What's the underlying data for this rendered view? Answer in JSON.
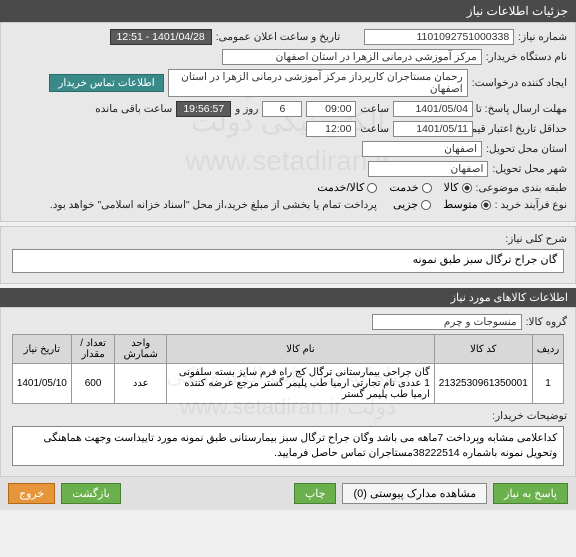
{
  "header": {
    "title": "جزئیات اطلاعات نیاز"
  },
  "form": {
    "need_no_label": "شماره نیاز:",
    "need_no": "1101092751000338",
    "announce_label": "تاریخ و ساعت اعلان عمومی:",
    "announce": "1401/04/28 - 12:51",
    "buyer_label": "نام دستگاه خریدار:",
    "buyer": "مرکز آموزشی درمانی الزهرا در استان اصفهان",
    "requester_label": "ایجاد کننده درخواست:",
    "requester": "رحمان مستاجران کارپرداز مرکز آموزشی درمانی الزهرا در استان اصفهان",
    "contact_btn": "اطلاعات تماس خریدار",
    "deadline_label": "مهلت ارسال پاسخ: تا تاریخ:",
    "deadline_date": "1401/05/04",
    "hour_label": "ساعت",
    "deadline_hour": "09:00",
    "days_left_pre": "",
    "days_left": "6",
    "days_left_mid": "روز و",
    "time_left": "19:56:57",
    "time_left_post": "ساعت باقی مانده",
    "validity_label": "حداقل تاریخ اعتبار قیمت: تا تاریخ:",
    "validity_date": "1401/05/11",
    "validity_hour": "12:00",
    "delivery_prov_label": "استان محل تحویل:",
    "delivery_prov": "اصفهان",
    "delivery_city_label": "شهر محل تحویل:",
    "delivery_city": "اصفهان",
    "classify_label": "طبقه بندی موضوعی:",
    "opt_goods": "کالا",
    "opt_service": "خدمت",
    "opt_both": "کالا/خدمت",
    "buy_type_label": "نوع فرآیند خرید :",
    "opt_mid": "متوسط",
    "opt_small": "جزیی",
    "buy_type_note": "پرداخت تمام یا بخشی از مبلغ خرید،از محل \"اسناد خزانه اسلامی\" خواهد بود."
  },
  "need_desc": {
    "label": "شرح کلی نیاز:",
    "text": "گان جراح ترگال سبز طبق نمونه"
  },
  "goods_section": {
    "title": "اطلاعات کالاهای مورد نیاز",
    "group_label": "گروه کالا:",
    "group": "منسوجات و چرم"
  },
  "table": {
    "headers": {
      "row": "ردیف",
      "code": "کد کالا",
      "name": "نام کالا",
      "unit": "واحد شمارش",
      "qty": "تعداد / مقدار",
      "date": "تاریخ نیاز"
    },
    "rows": [
      {
        "row": "1",
        "code": "2132530961350001",
        "name": "گان جراحی بیمارستانی ترگال کج راه فرم سایز بسته سلفونی 1 عددی نام تجارتی ارمیا طب پلیمر گستر مرجع عرضه کننده ارمیا طب پلیمر گستر",
        "unit": "عدد",
        "qty": "600",
        "date": "1401/05/10"
      }
    ]
  },
  "notes": {
    "label": "توضیحات خریدار:",
    "text": "کداعلامی مشابه وپرداخت 7ماهه می باشد وگان جراح ترگال سبز بیمارستانی طبق نمونه مورد تاییداست وجهت هماهنگی وتحویل نمونه باشماره 38222514مستاجران تماس حاصل فرمایید."
  },
  "footer": {
    "reply": "پاسخ به نیاز",
    "attach": "مشاهده مدارک پیوستی (0)",
    "print": "چاپ",
    "save": "بازگشت",
    "exit": "خروج"
  },
  "watermark": "سامانه تدارکات الکترونیکی دولت\nwww.setadiran.ir"
}
